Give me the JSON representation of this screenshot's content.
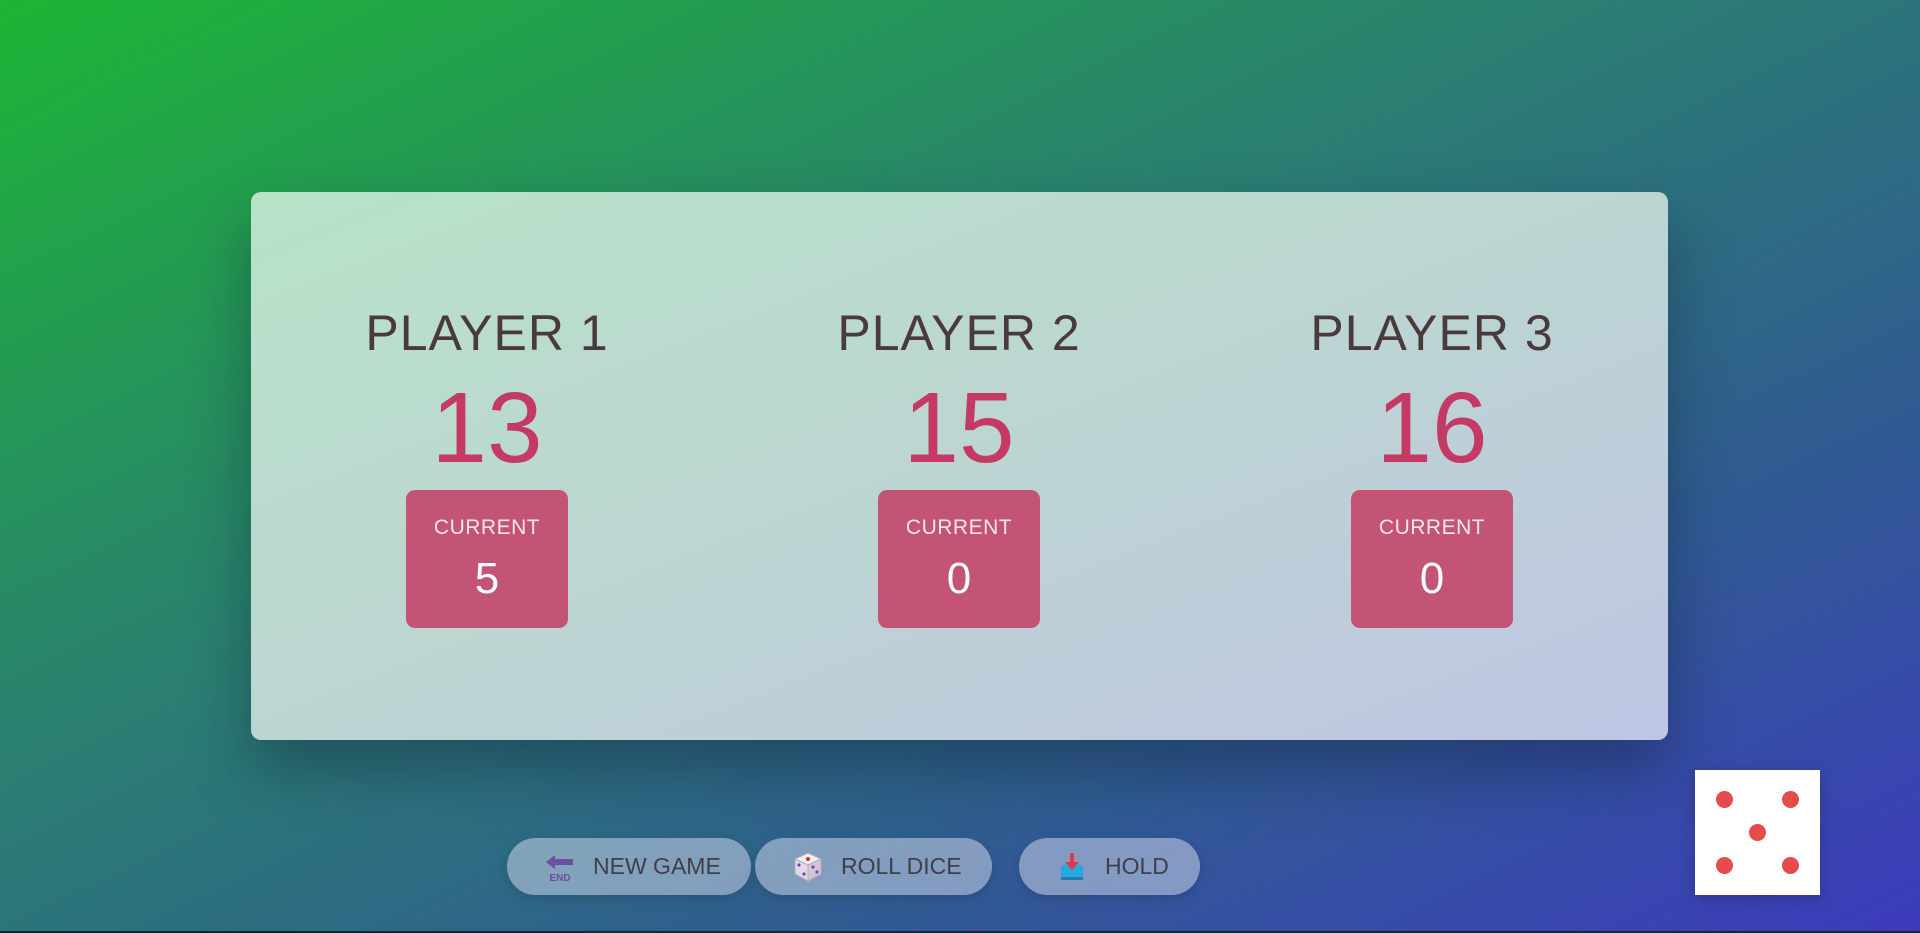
{
  "players": [
    {
      "name": "PLAYER 1",
      "score": "13",
      "current_label": "CURRENT",
      "current_score": "5"
    },
    {
      "name": "PLAYER 2",
      "score": "15",
      "current_label": "CURRENT",
      "current_score": "0"
    },
    {
      "name": "PLAYER 3",
      "score": "16",
      "current_label": "CURRENT",
      "current_score": "0"
    }
  ],
  "controls": {
    "new_game": {
      "label": "NEW GAME",
      "icon": "end-arrow-icon"
    },
    "roll_dice": {
      "label": "ROLL DICE",
      "icon": "dice-icon"
    },
    "hold": {
      "label": "HOLD",
      "icon": "hold-icon"
    }
  },
  "dice": {
    "value": 5,
    "pip_color": "#e54b4b"
  },
  "colors": {
    "accent": "#c43a65",
    "current_box": "#c45475",
    "panel_start": "#b8e2c8",
    "panel_end": "#bfc5e4"
  }
}
